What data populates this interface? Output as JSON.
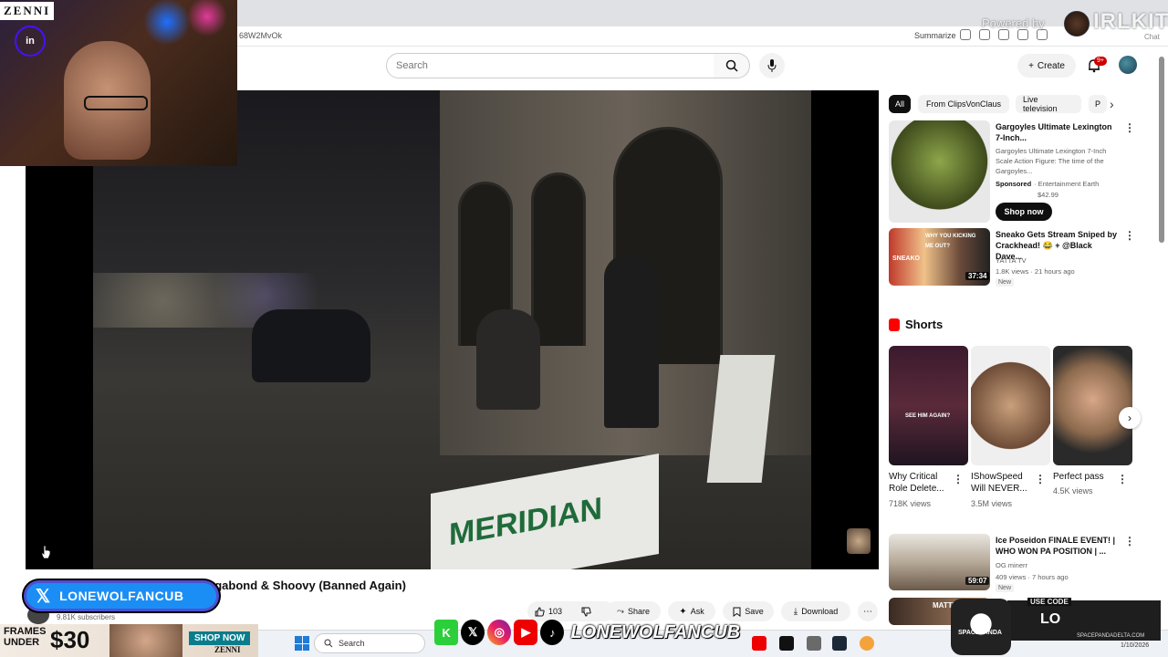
{
  "browser": {
    "url": "68W2MvOk",
    "summarize_label": "Summarize",
    "chat_label": "Chat"
  },
  "overlay": {
    "webcam_brand": "ZENNI",
    "neon_sign": "in",
    "powered_by": "Powered by",
    "powered_brand": "IRLKIT",
    "twitter_handle": "LONEWOLFANCUB",
    "social_handle": "LONEWOLFANCUB",
    "frames_text": "FRAMES UNDER",
    "frames_price": "$30",
    "shop_now": "SHOP NOW",
    "zenni_small": "ZENNI",
    "panda_code": "USE CODE",
    "panda_name": "SPACEPANDA",
    "panda_lo": "LO",
    "panda_url": "SPACEPANDADELTA.COM"
  },
  "header": {
    "search_placeholder": "Search",
    "create_label": "Create",
    "notif_count": "9+"
  },
  "video": {
    "sign_text": "MERIDIAN",
    "title_visible": "agabond & Shoovy (Banned Again)",
    "subscribers": "9.81K subscribers",
    "actions": {
      "like_count": "103",
      "share": "Share",
      "ask": "Ask",
      "save": "Save",
      "download": "Download"
    }
  },
  "chips": [
    "All",
    "From ClipsVonClaus",
    "Live television",
    "P"
  ],
  "sidebar": {
    "ad": {
      "title": "Gargoyles Ultimate Lexington 7-Inch...",
      "desc": "Gargoyles Ultimate Lexington 7-Inch Scale Action Figure: The time of the Gargoyles...",
      "sponsored": "Sponsored",
      "advertiser": "· Entertainment Earth",
      "price": "$42.99",
      "shop_btn": "Shop now"
    },
    "video1": {
      "title": "Sneako Gets Stream Sniped by Crackhead! 😂 + @Black Dave...",
      "channel": "YATTA TV",
      "meta": "1.8K views · 21 hours ago",
      "badge": "New",
      "duration": "37:34",
      "thumb_caption": "WHY YOU KICKING ME OUT?",
      "thumb_label": "SNEAKO"
    },
    "shorts_label": "Shorts",
    "shorts": [
      {
        "title": "Why Critical Role Delete...",
        "views": "718K views",
        "caption": "SEE HIM AGAIN?"
      },
      {
        "title": "IShowSpeed Will NEVER...",
        "views": "3.5M views"
      },
      {
        "title": "Perfect pass",
        "views": "4.5K views"
      }
    ],
    "video2": {
      "title": "Ice Poseidon FINALE EVENT! | WHO WON PA POSITION | ...",
      "channel": "OG minerr",
      "meta": "409 views · 7 hours ago",
      "badge": "New",
      "duration": "59:07"
    },
    "video3": {
      "thumb_text": "MATT'S 5 YEA"
    }
  },
  "taskbar": {
    "search_label": "Search",
    "date": "1/10/2026"
  }
}
